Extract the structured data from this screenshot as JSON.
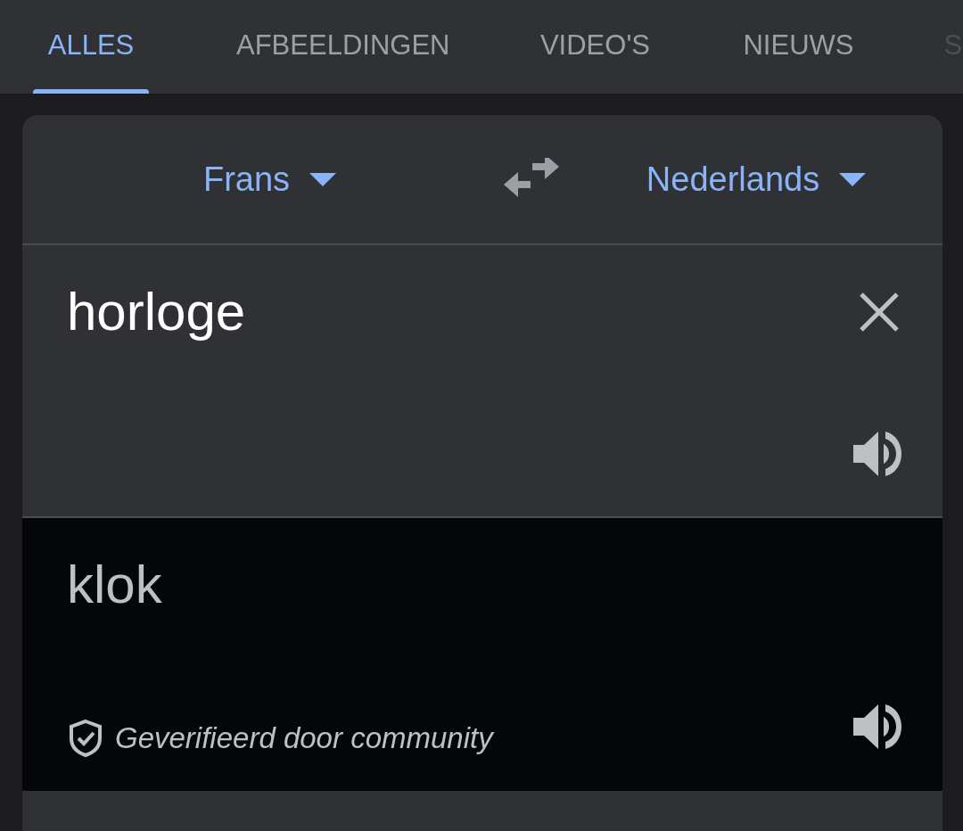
{
  "tabs": [
    {
      "label": "ALLES",
      "selected": true
    },
    {
      "label": "AFBEELDINGEN",
      "selected": false
    },
    {
      "label": "VIDEO'S",
      "selected": false
    },
    {
      "label": "NIEUWS",
      "selected": false
    },
    {
      "label": "S",
      "selected": false,
      "cut": true
    }
  ],
  "translator": {
    "source_language": "Frans",
    "target_language": "Nederlands",
    "input": {
      "value": "horloge"
    },
    "output": {
      "text": "klok",
      "verified_note": "Geverifieerd door community"
    }
  }
}
